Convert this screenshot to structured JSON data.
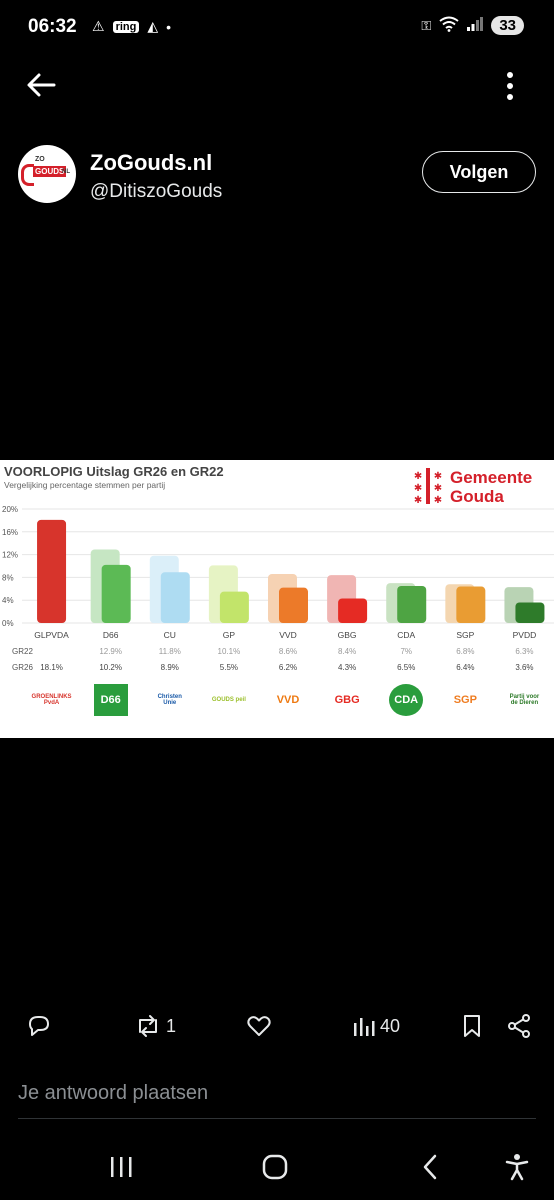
{
  "status": {
    "time": "06:32",
    "battery": "33",
    "ring": "ring"
  },
  "post": {
    "display_name": "ZoGouds.nl",
    "handle": "@DitiszoGouds",
    "follow_label": "Volgen",
    "avatar_text_top": "ZO",
    "avatar_text_main": "GOUDS",
    "avatar_text_suffix": "NL"
  },
  "chart_data": {
    "type": "bar",
    "title": "VOORLOPIG Uitslag GR26 en GR22",
    "subtitle": "Vergelijking percentage stemmen per partij",
    "categories": [
      "GLPVDA",
      "D66",
      "CU",
      "GP",
      "VVD",
      "GBG",
      "CDA",
      "SGP",
      "PVDD"
    ],
    "series": [
      {
        "name": "GR22",
        "values": [
          null,
          12.9,
          11.8,
          10.1,
          8.6,
          8.4,
          7,
          6.8,
          6.3
        ]
      },
      {
        "name": "GR26",
        "values": [
          18.1,
          10.2,
          8.9,
          5.5,
          6.2,
          4.3,
          6.5,
          6.4,
          3.6
        ]
      }
    ],
    "table_rows": [
      {
        "label": "GR22",
        "cells": [
          "",
          "12.9%",
          "11.8%",
          "10.1%",
          "8.6%",
          "8.4%",
          "7%",
          "6.8%",
          "6.3%"
        ]
      },
      {
        "label": "GR26",
        "cells": [
          "18.1%",
          "10.2%",
          "8.9%",
          "5.5%",
          "6.2%",
          "4.3%",
          "6.5%",
          "6.4%",
          "3.6%"
        ]
      }
    ],
    "yticks": [
      "0%",
      "4%",
      "8%",
      "12%",
      "16%",
      "20%"
    ],
    "ylim": [
      0,
      20
    ],
    "colors_gr26": [
      "#d7342c",
      "#5cba55",
      "#aedcf2",
      "#c2e46a",
      "#ec7a29",
      "#e52b24",
      "#4ea443",
      "#e99c33",
      "#2e7b2a"
    ],
    "colors_gr22": [
      "#d7342c",
      "#c6e6c3",
      "#dbeff9",
      "#e6f3c4",
      "#f6d2b3",
      "#f0b5b3",
      "#c9e2c2",
      "#f4d6b0",
      "#b9d3b4"
    ],
    "grid": true,
    "legend": "none"
  },
  "chart_brand": {
    "line1": "Gemeente",
    "line2": "Gouda"
  },
  "party_logos": [
    {
      "label": "GROENLINKS PvdA",
      "color": "#d7342c"
    },
    {
      "label": "D66",
      "color": "#2a9d3d"
    },
    {
      "label": "Christen Unie",
      "color": "#1a5aa8"
    },
    {
      "label": "GOUDS peil",
      "color": "#9bbf2a"
    },
    {
      "label": "VVD",
      "color": "#ee7a12"
    },
    {
      "label": "GBG",
      "color": "#e52b24"
    },
    {
      "label": "CDA",
      "color": "#2a9d3d"
    },
    {
      "label": "SGP",
      "color": "#ef7d22"
    },
    {
      "label": "Partij voor de Dieren",
      "color": "#2e7b2a"
    }
  ],
  "actions": {
    "retweet_count": "1",
    "views_count": "40"
  },
  "reply": {
    "placeholder": "Je antwoord plaatsen"
  }
}
